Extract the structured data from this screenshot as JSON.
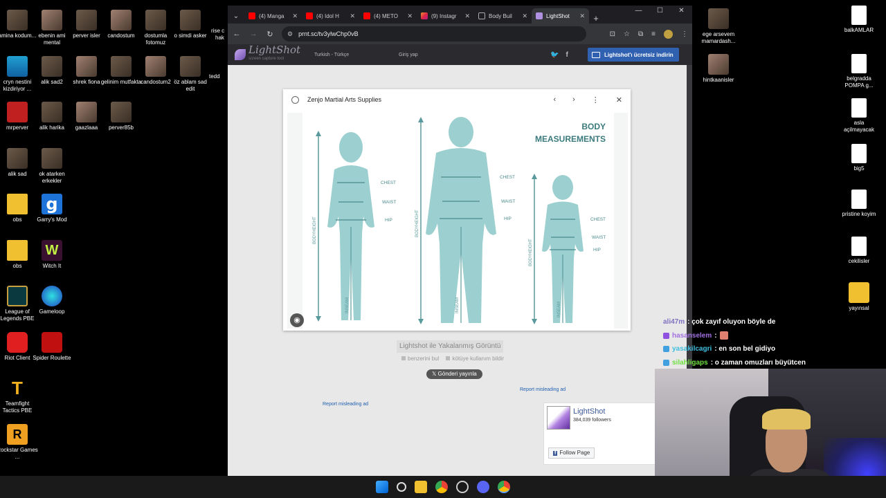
{
  "desktop": {
    "left_icons": [
      {
        "label": "amina kodum...",
        "type": "photo"
      },
      {
        "label": "ebenin ami mental",
        "type": "photo2"
      },
      {
        "label": "perver isler",
        "type": "photo"
      },
      {
        "label": "candostum",
        "type": "photo2"
      },
      {
        "label": "dostumla fotomuz",
        "type": "photo"
      },
      {
        "label": "o simdi asker",
        "type": "photo"
      },
      {
        "label": "cryn nestini kizdiriyor ...",
        "type": "cryn"
      },
      {
        "label": "alik sad2",
        "type": "photo"
      },
      {
        "label": "shrek fiona",
        "type": "photo2"
      },
      {
        "label": "gelinim mutfakta",
        "type": "photo"
      },
      {
        "label": "candostum2",
        "type": "photo2"
      },
      {
        "label": "öz ablam sad edit",
        "type": "photo"
      },
      {
        "label": "mrperver",
        "type": "mrperver"
      },
      {
        "label": "alik harika",
        "type": "photo"
      },
      {
        "label": "gaazlaaa",
        "type": "photo2"
      },
      {
        "label": "perver85b",
        "type": "photo"
      },
      {
        "label": "alik sad",
        "type": "photo"
      },
      {
        "label": "ok atarken erkekler",
        "type": "photo"
      },
      {
        "label": "obs",
        "type": "folder"
      },
      {
        "label": "Garry's Mod",
        "type": "gmod",
        "glyph": "g"
      },
      {
        "label": "obs",
        "type": "folder"
      },
      {
        "label": "Witch It",
        "type": "witch",
        "glyph": "W"
      },
      {
        "label": "League of Legends PBE",
        "type": "lol"
      },
      {
        "label": "Gameloop",
        "type": "gameloop"
      },
      {
        "label": "Riot Client",
        "type": "riot"
      },
      {
        "label": "Spider Roulette",
        "type": "spider"
      },
      {
        "label": "Teamfight Tactics PBE",
        "type": "tft",
        "glyph": "T"
      },
      {
        "label": "Rockstar Games ...",
        "type": "rockstar",
        "glyph": "R"
      }
    ],
    "top_partial_labels": [
      "rise c",
      "hak",
      "tedd"
    ],
    "right_icons": [
      {
        "label": "ege arsevem mamardash...",
        "type": "photo"
      },
      {
        "label": "hintkaanisler",
        "type": "photo2"
      },
      {
        "label": "balkAMLAR",
        "type": "file"
      },
      {
        "label": "belgradda POMPA g...",
        "type": "file"
      },
      {
        "label": "asla açilmayacak",
        "type": "file"
      },
      {
        "label": "big5",
        "type": "file"
      },
      {
        "label": "pristine koyim",
        "type": "file"
      },
      {
        "label": "cekilisler",
        "type": "file"
      },
      {
        "label": "yayınsal",
        "type": "yayinsal"
      }
    ]
  },
  "browser": {
    "tabs": [
      {
        "title": "(4) Manga",
        "icon": "yt"
      },
      {
        "title": "(4) Idol H",
        "icon": "yt"
      },
      {
        "title": "(4) METO",
        "icon": "yt"
      },
      {
        "title": "(9) Instagr",
        "icon": "ig"
      },
      {
        "title": "Body Buil",
        "icon": "globe"
      },
      {
        "title": "LightShot",
        "icon": "feather",
        "active": true
      }
    ],
    "new_tab_glyph": "+",
    "tab_dropdown_glyph": "⌄",
    "window_controls": [
      "—",
      "☐",
      "✕"
    ],
    "url": "prnt.sc/tv3ylwChp0vB",
    "nav": {
      "back": "←",
      "forward": "→",
      "reload": "↻"
    }
  },
  "lightshot": {
    "logo": "LightShot",
    "logo_sub": "screen capture tool",
    "language": "Turkish - Türkçe",
    "login": "Giriş yap",
    "download_button": "Lightshot'ı ücretsiz indirin",
    "social": [
      "twitter-icon",
      "facebook-icon"
    ],
    "screenshot": {
      "site_name": "Zenjo Martial Arts Supplies",
      "image_title_line1": "BODY",
      "image_title_line2": "MEASUREMENTS",
      "labels": {
        "chest": "CHEST",
        "waist": "WAIST",
        "hip": "HIP",
        "bodyheight": "BODYHEIGHT",
        "inseam": "INSEAM"
      }
    },
    "caption": "Lightshot ile Yakalanmış Görüntü",
    "find_similar": "benzerini bul",
    "report_abuse": "kötüye kullanım bildir",
    "tweet_button": "Gönderi yayınla",
    "report_ad_1": "Report misleading ad",
    "report_ad_2": "Report misleading ad",
    "facebook": {
      "name": "LightShot",
      "followers": "384,039 followers",
      "follow_button": "Follow Page"
    }
  },
  "chat": [
    {
      "user": "ali47m",
      "message": ": çok zayıf oluyon böyle de"
    },
    {
      "user": "hasanselem",
      "message": ":"
    },
    {
      "user": "yasakilcagri",
      "message": ": en son bel gidiyo"
    },
    {
      "user": "silahligaps",
      "message": ": o zaman omuzları büyütcen"
    }
  ]
}
